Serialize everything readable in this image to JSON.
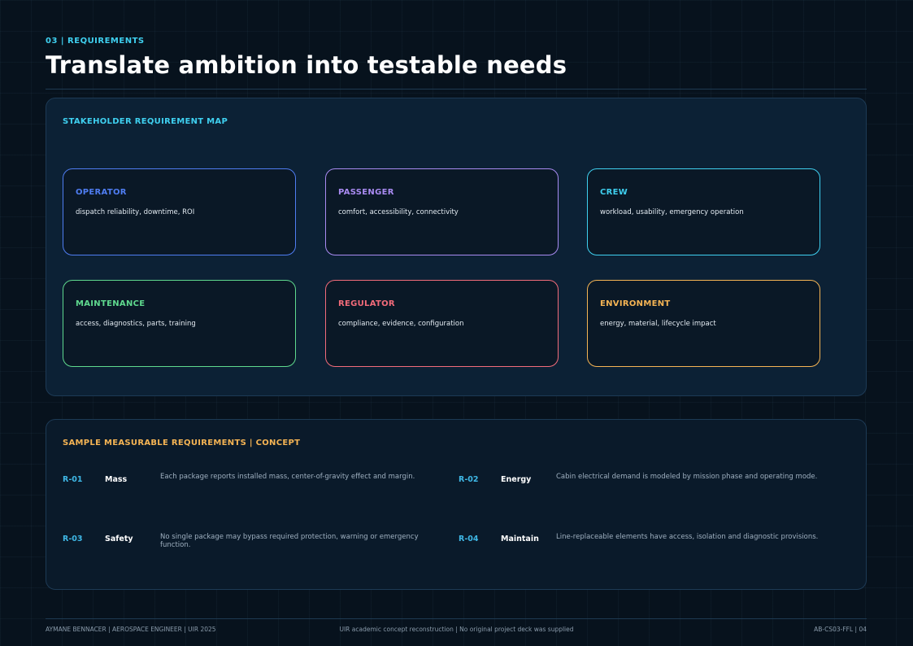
{
  "header": {
    "kicker": "03 | REQUIREMENTS",
    "title": "Translate ambition into testable needs"
  },
  "stakeholder_map": {
    "title": "STAKEHOLDER REQUIREMENT MAP",
    "cards": [
      {
        "label": "OPERATOR",
        "desc": "dispatch reliability, downtime, ROI",
        "color": "#4f7df2"
      },
      {
        "label": "PASSENGER",
        "desc": "comfort, accessibility, connectivity",
        "color": "#a98bf2"
      },
      {
        "label": "CREW",
        "desc": "workload, usability, emergency operation",
        "color": "#3fd0f0"
      },
      {
        "label": "MAINTENANCE",
        "desc": "access, diagnostics, parts, training",
        "color": "#5fd98e"
      },
      {
        "label": "REGULATOR",
        "desc": "compliance, evidence, configuration",
        "color": "#f26b7a"
      },
      {
        "label": "ENVIRONMENT",
        "desc": "energy, material, lifecycle impact",
        "color": "#f5b454"
      }
    ]
  },
  "requirements": {
    "title": "SAMPLE MEASURABLE REQUIREMENTS | CONCEPT",
    "items": [
      {
        "id": "R-01",
        "name": "Mass",
        "text": "Each package reports installed mass, center-of-gravity effect and margin."
      },
      {
        "id": "R-02",
        "name": "Energy",
        "text": "Cabin electrical demand is modeled by mission phase and operating mode."
      },
      {
        "id": "R-03",
        "name": "Safety",
        "text": "No single package may bypass required protection, warning or emergency function."
      },
      {
        "id": "R-04",
        "name": "Maintain",
        "text": "Line-replaceable elements have access, isolation and diagnostic provisions."
      }
    ]
  },
  "footer": {
    "left": "AYMANE BENNACER | AEROSPACE ENGINEER | UIR 2025",
    "center": "UIR academic concept reconstruction | No original project deck was supplied",
    "right": "AB-CS03-FFL | 04"
  },
  "colors": {
    "accent": "#3fd0f0",
    "warm_accent": "#f5b454",
    "background": "#07121d"
  }
}
